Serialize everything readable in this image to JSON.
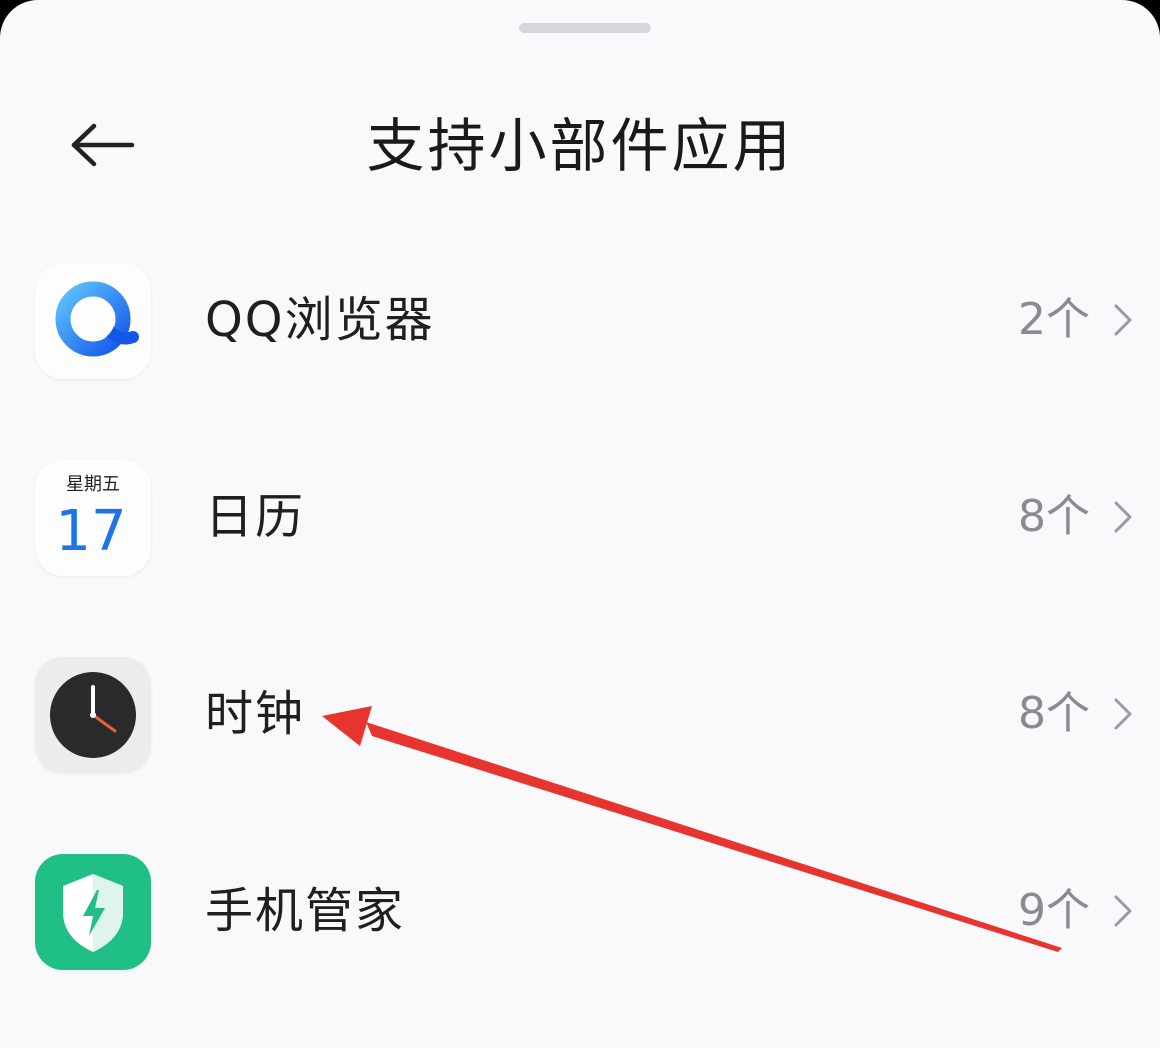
{
  "header": {
    "title": "支持小部件应用",
    "back_icon": "back-arrow-icon"
  },
  "apps": [
    {
      "name": "QQ浏览器",
      "count": "2个",
      "icon": "qq-browser-icon"
    },
    {
      "name": "日历",
      "count": "8个",
      "icon": "calendar-icon",
      "icon_weekday": "星期五",
      "icon_day": "17"
    },
    {
      "name": "时钟",
      "count": "8个",
      "icon": "clock-icon"
    },
    {
      "name": "手机管家",
      "count": "9个",
      "icon": "phone-manager-icon"
    }
  ],
  "colors": {
    "background": "#f9f9fb",
    "annotation_arrow": "#e8342f",
    "phone_manager_green": "#1fbf85",
    "calendar_blue": "#1e74e6"
  }
}
